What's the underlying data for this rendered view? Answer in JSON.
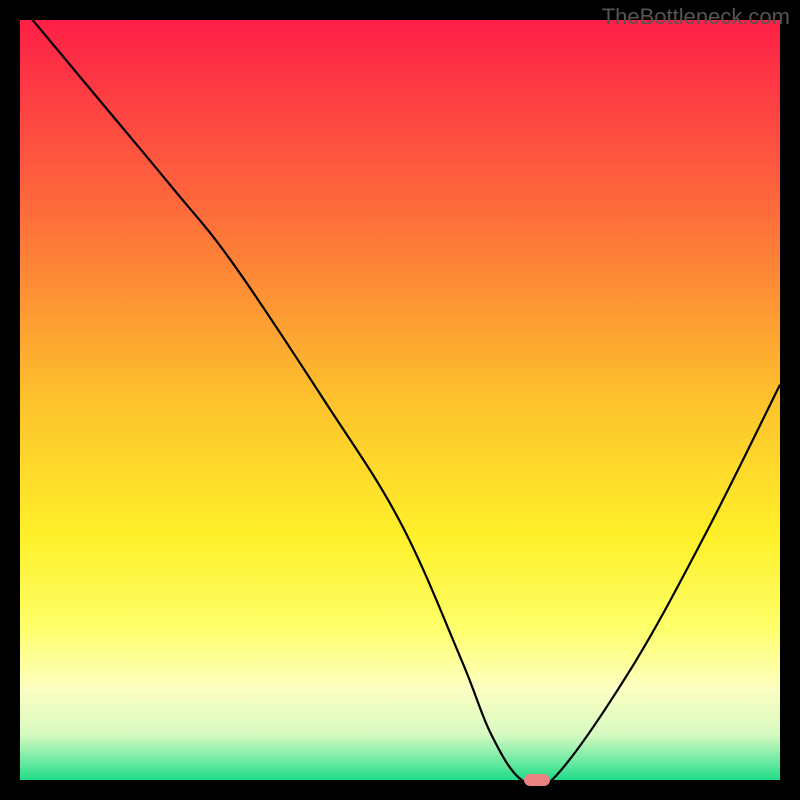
{
  "watermark": "TheBottleneck.com",
  "chart_data": {
    "type": "line",
    "title": "",
    "xlabel": "",
    "ylabel": "",
    "xlim": [
      0,
      100
    ],
    "ylim": [
      0,
      100
    ],
    "x": [
      0,
      10,
      20,
      28,
      40,
      50,
      58,
      62,
      66,
      70,
      80,
      90,
      100
    ],
    "values": [
      102,
      90,
      78,
      68,
      50,
      34,
      16,
      6,
      0,
      0,
      14,
      32,
      52
    ],
    "marker": {
      "x": 68,
      "y": 0
    },
    "gradient_stops": [
      {
        "offset": 0,
        "color": "#fd1f47"
      },
      {
        "offset": 0.25,
        "color": "#fd6b3b"
      },
      {
        "offset": 0.5,
        "color": "#fdc22c"
      },
      {
        "offset": 0.68,
        "color": "#fef029"
      },
      {
        "offset": 0.8,
        "color": "#feff6a"
      },
      {
        "offset": 0.88,
        "color": "#fdffc2"
      },
      {
        "offset": 0.94,
        "color": "#d7fac1"
      },
      {
        "offset": 0.98,
        "color": "#5fe89e"
      },
      {
        "offset": 1.0,
        "color": "#1edb87"
      }
    ]
  }
}
